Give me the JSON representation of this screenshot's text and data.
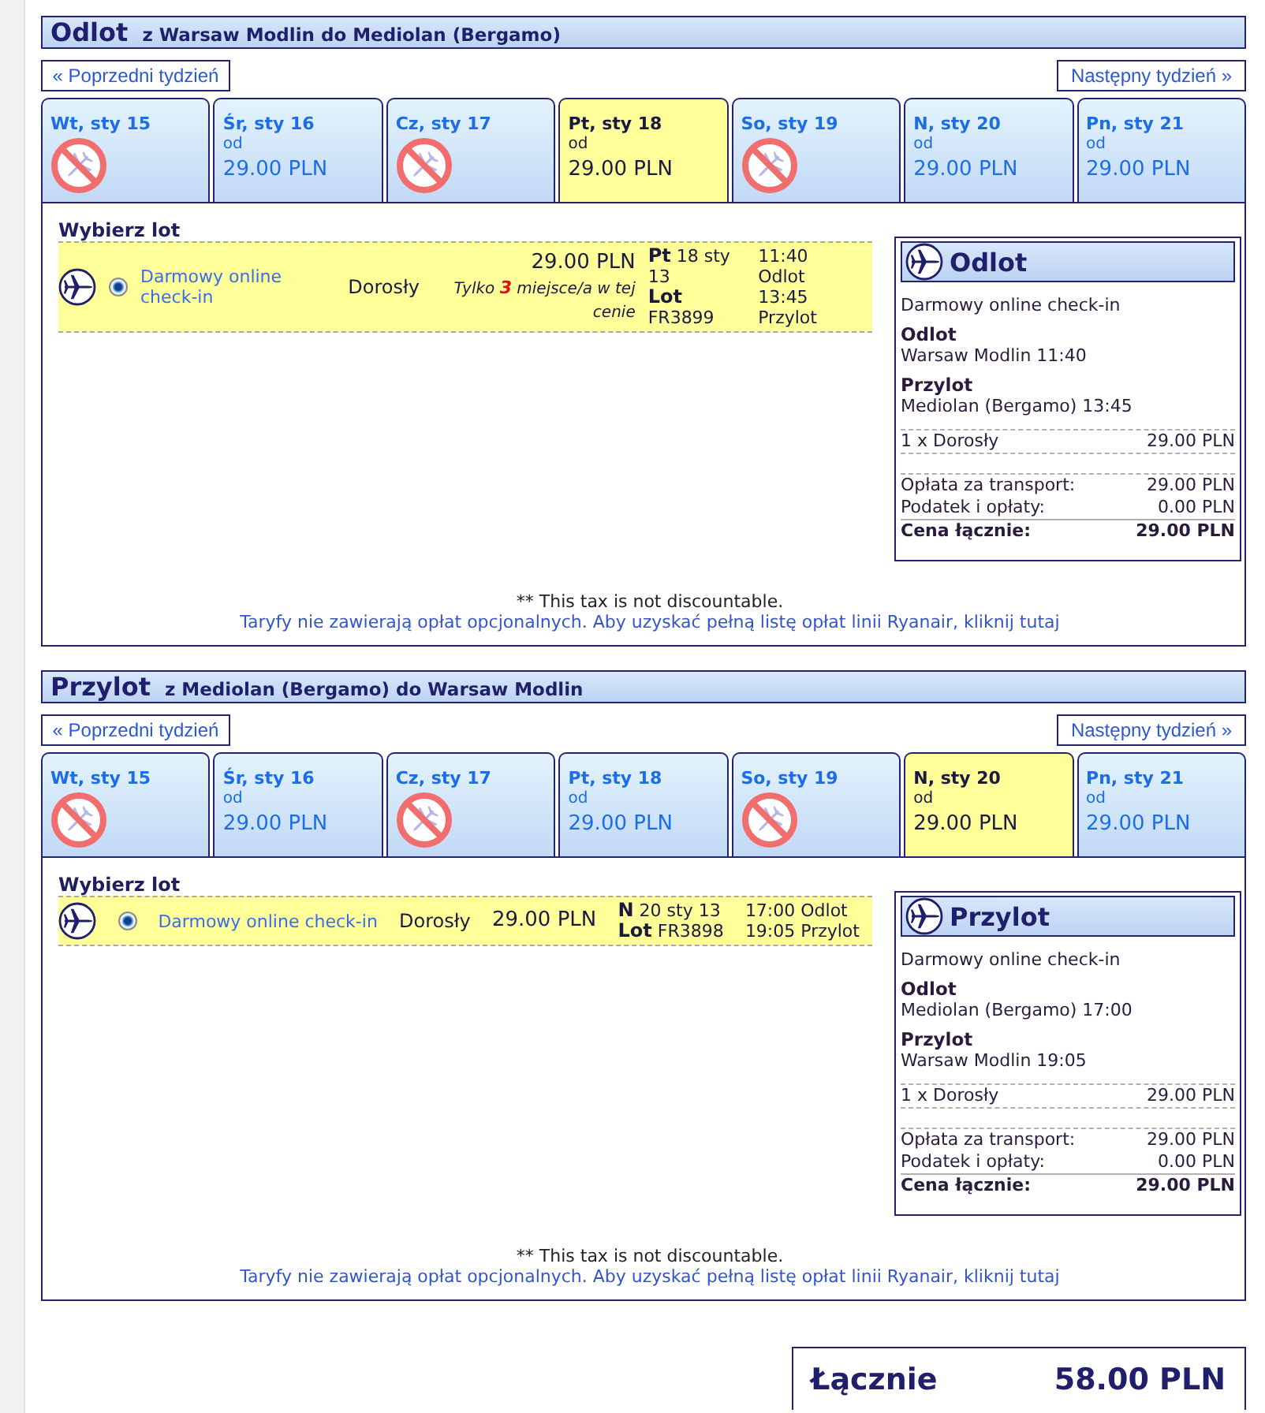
{
  "sections": [
    {
      "title": "Odlot",
      "route": "z Warsaw Modlin do Mediolan (Bergamo)",
      "prev_week": "« Poprzedni tydzień",
      "next_week": "Następny tydzień »",
      "tabs": [
        {
          "date": "Wt, sty 15",
          "kind": "no-flights",
          "selected": false
        },
        {
          "date": "Śr, sty 16",
          "kind": "fare",
          "from_label": "od",
          "price": "29.00 PLN",
          "selected": false
        },
        {
          "date": "Cz, sty 17",
          "kind": "no-flights",
          "selected": false
        },
        {
          "date": "Pt, sty 18",
          "kind": "fare",
          "from_label": "od",
          "price": "29.00 PLN",
          "selected": true
        },
        {
          "date": "So, sty 19",
          "kind": "no-flights",
          "selected": false
        },
        {
          "date": "N, sty 20",
          "kind": "fare",
          "from_label": "od",
          "price": "29.00 PLN",
          "selected": false
        },
        {
          "date": "Pn, sty 21",
          "kind": "fare",
          "from_label": "od",
          "price": "29.00 PLN",
          "selected": false
        }
      ],
      "list_title": "Wybierz lot",
      "flights": [
        {
          "selected": true,
          "fare": "Darmowy online check-in",
          "passenger": "Dorosły",
          "price": "29.00 PLN",
          "availability": "Tylko **3** miejsce/a w tej cenie",
          "date": "**Pt** 18 sty 13",
          "flight": "**Lot** FR3899",
          "departure": "11:40 Odlot",
          "arrival": "13:45 Przylot"
        }
      ],
      "summary": {
        "title": "Odlot",
        "fare": "Darmowy online check-in",
        "departure_label": "Odlot",
        "departure": "Warsaw Modlin 11:40",
        "arrival_label": "Przylot",
        "arrival": "Mediolan (Bergamo) 13:45",
        "passengers": [
          {
            "label": "1 x Dorosły",
            "amount": "29.00 PLN"
          }
        ],
        "charges": [
          {
            "label": "Opłata za transport:",
            "amount": "29.00 PLN"
          },
          {
            "label": "Podatek i opłaty:",
            "amount": "0.00 PLN"
          }
        ],
        "total": {
          "label": "Cena łącznie:",
          "amount": "29.00 PLN"
        }
      },
      "tax_note": "** This tax is not discountable.",
      "fees_link": "Taryfy nie zawierają opłat opcjonalnych. Aby uzyskać pełną listę opłat linii Ryanair, kliknij tutaj"
    },
    {
      "title": "Przylot",
      "route": "z Mediolan (Bergamo) do Warsaw Modlin",
      "prev_week": "« Poprzedni tydzień",
      "next_week": "Następny tydzień »",
      "tabs": [
        {
          "date": "Wt, sty 15",
          "kind": "no-flights",
          "selected": false
        },
        {
          "date": "Śr, sty 16",
          "kind": "fare",
          "from_label": "od",
          "price": "29.00 PLN",
          "selected": false
        },
        {
          "date": "Cz, sty 17",
          "kind": "no-flights",
          "selected": false
        },
        {
          "date": "Pt, sty 18",
          "kind": "fare",
          "from_label": "od",
          "price": "29.00 PLN",
          "selected": false
        },
        {
          "date": "So, sty 19",
          "kind": "no-flights",
          "selected": false
        },
        {
          "date": "N, sty 20",
          "kind": "fare",
          "from_label": "od",
          "price": "29.00 PLN",
          "selected": true
        },
        {
          "date": "Pn, sty 21",
          "kind": "fare",
          "from_label": "od",
          "price": "29.00 PLN",
          "selected": false
        }
      ],
      "list_title": "Wybierz lot",
      "flights": [
        {
          "selected": true,
          "fare": "Darmowy online check-in",
          "passenger": "Dorosły",
          "price": "29.00 PLN",
          "date": "**N** 20 sty 13",
          "flight": "**Lot** FR3898",
          "departure": "17:00 Odlot",
          "arrival": "19:05 Przylot"
        }
      ],
      "summary": {
        "title": "Przylot",
        "fare": "Darmowy online check-in",
        "departure_label": "Odlot",
        "departure": "Mediolan (Bergamo) 17:00",
        "arrival_label": "Przylot",
        "arrival": "Warsaw Modlin 19:05",
        "passengers": [
          {
            "label": "1 x Dorosły",
            "amount": "29.00 PLN"
          }
        ],
        "charges": [
          {
            "label": "Opłata za transport:",
            "amount": "29.00 PLN"
          },
          {
            "label": "Podatek i opłaty:",
            "amount": "0.00 PLN"
          }
        ],
        "total": {
          "label": "Cena łącznie:",
          "amount": "29.00 PLN"
        }
      },
      "tax_note": "** This tax is not discountable.",
      "fees_link": "Taryfy nie zawierają opłat opcjonalnych. Aby uzyskać pełną listę opłat linii Ryanair, kliknij tutaj"
    }
  ],
  "total": {
    "label": "Łącznie",
    "amount": "58.00 PLN"
  }
}
